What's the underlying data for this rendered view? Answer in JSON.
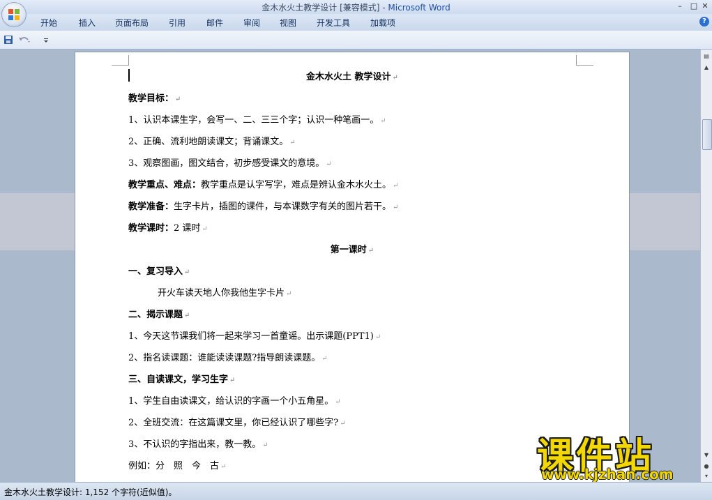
{
  "window": {
    "title_doc": "金木水火土教学设计 [兼容模式] - ",
    "title_app": "Microsoft Word",
    "minimize": "–",
    "maximize": "□",
    "close": "✕"
  },
  "ribbon": {
    "tabs": [
      "开始",
      "插入",
      "页面布局",
      "引用",
      "邮件",
      "审阅",
      "视图",
      "开发工具",
      "加载项"
    ],
    "help": "?"
  },
  "quick_access": {
    "icons": [
      "save-icon",
      "undo-icon",
      "customize-icon"
    ]
  },
  "document": {
    "title": "金木水火土 教学设计",
    "pilcrow": "↵",
    "goals_head": "教学目标：",
    "goal1": "1、认识本课生字，会写一、二、三三个字；认识一种笔画一。",
    "goal2": "2、正确、流利地朗读课文；背诵课文。",
    "goal3": "3、观察图画，图文结合，初步感受课文的意境。",
    "key_head": "教学重点、难点：",
    "key_text": "教学重点是认字写字，难点是辨认金木水火土。",
    "prep_head": "教学准备：",
    "prep_text": "生字卡片，插图的课件，与本课数字有关的图片若干。",
    "hours_head": "教学课时：",
    "hours_text": "2 课时",
    "lesson1": "第一课时",
    "sec1": "一、复习导入",
    "sec1_text": "开火车读天地人你我他生字卡片",
    "sec2": "二、揭示课题",
    "sec2_1": "1、今天这节课我们将一起来学习一首童谣。出示课题(PPT1)",
    "sec2_2": "2、指名读课题：谁能读读课题?指导朗读课题。",
    "sec3": "三、自读课文，学习生字",
    "sec3_1": "1、学生自由读课文，给认识的字画一个小五角星。",
    "sec3_2": "2、全班交流：在这篇课文里，你已经认识了哪些字?",
    "sec3_3": "3、不认识的字指出来，教一教。",
    "example": "例如：分　照　今　古"
  },
  "watermark": {
    "cn": "课件站",
    "url": "www.kjzhan.com"
  },
  "status": {
    "text": "金木水火土教学设计: 1,152 个字符(近似值)。"
  }
}
